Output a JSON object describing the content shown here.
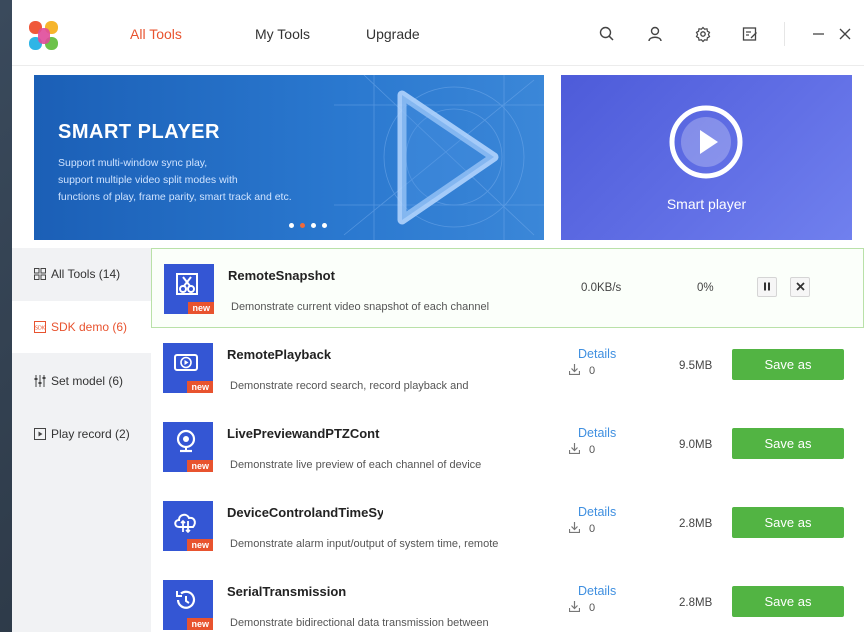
{
  "header": {
    "tabs": [
      {
        "label": "All Tools",
        "active": true
      },
      {
        "label": "My Tools",
        "active": false
      },
      {
        "label": "Upgrade",
        "active": false
      }
    ],
    "icons": [
      "search-icon",
      "user-icon",
      "settings-icon",
      "feedback-icon",
      "minimize-icon",
      "close-icon"
    ],
    "accent_color": "#e8532f"
  },
  "banner": {
    "title": "SMART PLAYER",
    "desc_lines": [
      "Support multi-window sync play,",
      "support multiple video split modes with",
      "functions of play, frame parity, smart track and etc."
    ],
    "slides_count": 4,
    "active_slide": 2,
    "side_label": "Smart player"
  },
  "sidebar": {
    "items": [
      {
        "label": "All Tools (14)",
        "icon": "grid-icon",
        "active": false
      },
      {
        "label": "SDK demo (6)",
        "icon": "sdk-icon",
        "active": true
      },
      {
        "label": "Set model (6)",
        "icon": "sliders-icon",
        "active": false
      },
      {
        "label": "Play record (2)",
        "icon": "play-record-icon",
        "active": false
      }
    ]
  },
  "tools": [
    {
      "name": "RemoteSnapshot",
      "desc": "Demonstrate current video snapshot of each channel",
      "badge": "new",
      "state": "downloading",
      "speed": "0.0KB/s",
      "progress": "0%",
      "icon": "snapshot-icon"
    },
    {
      "name": "RemotePlayback",
      "desc": "Demonstrate record search, record playback and",
      "badge": "new",
      "details": "Details",
      "downloads": "0",
      "size": "9.5MB",
      "action": "Save as",
      "icon": "playback-icon"
    },
    {
      "name": "LivePreviewandPTZCont",
      "desc": "Demonstrate live preview of each channel of device",
      "badge": "new",
      "details": "Details",
      "downloads": "0",
      "size": "9.0MB",
      "action": "Save as",
      "icon": "webcam-icon"
    },
    {
      "name": "DeviceControlandTimeSy",
      "desc": "Demonstrate alarm input/output of system time, remote",
      "badge": "new",
      "details": "Details",
      "downloads": "0",
      "size": "2.8MB",
      "action": "Save as",
      "icon": "cloud-sync-icon"
    },
    {
      "name": "SerialTransmission",
      "desc": "Demonstrate bidirectional data transmission between",
      "badge": "new",
      "details": "Details",
      "downloads": "0",
      "size": "2.8MB",
      "action": "Save as",
      "icon": "history-icon"
    }
  ]
}
